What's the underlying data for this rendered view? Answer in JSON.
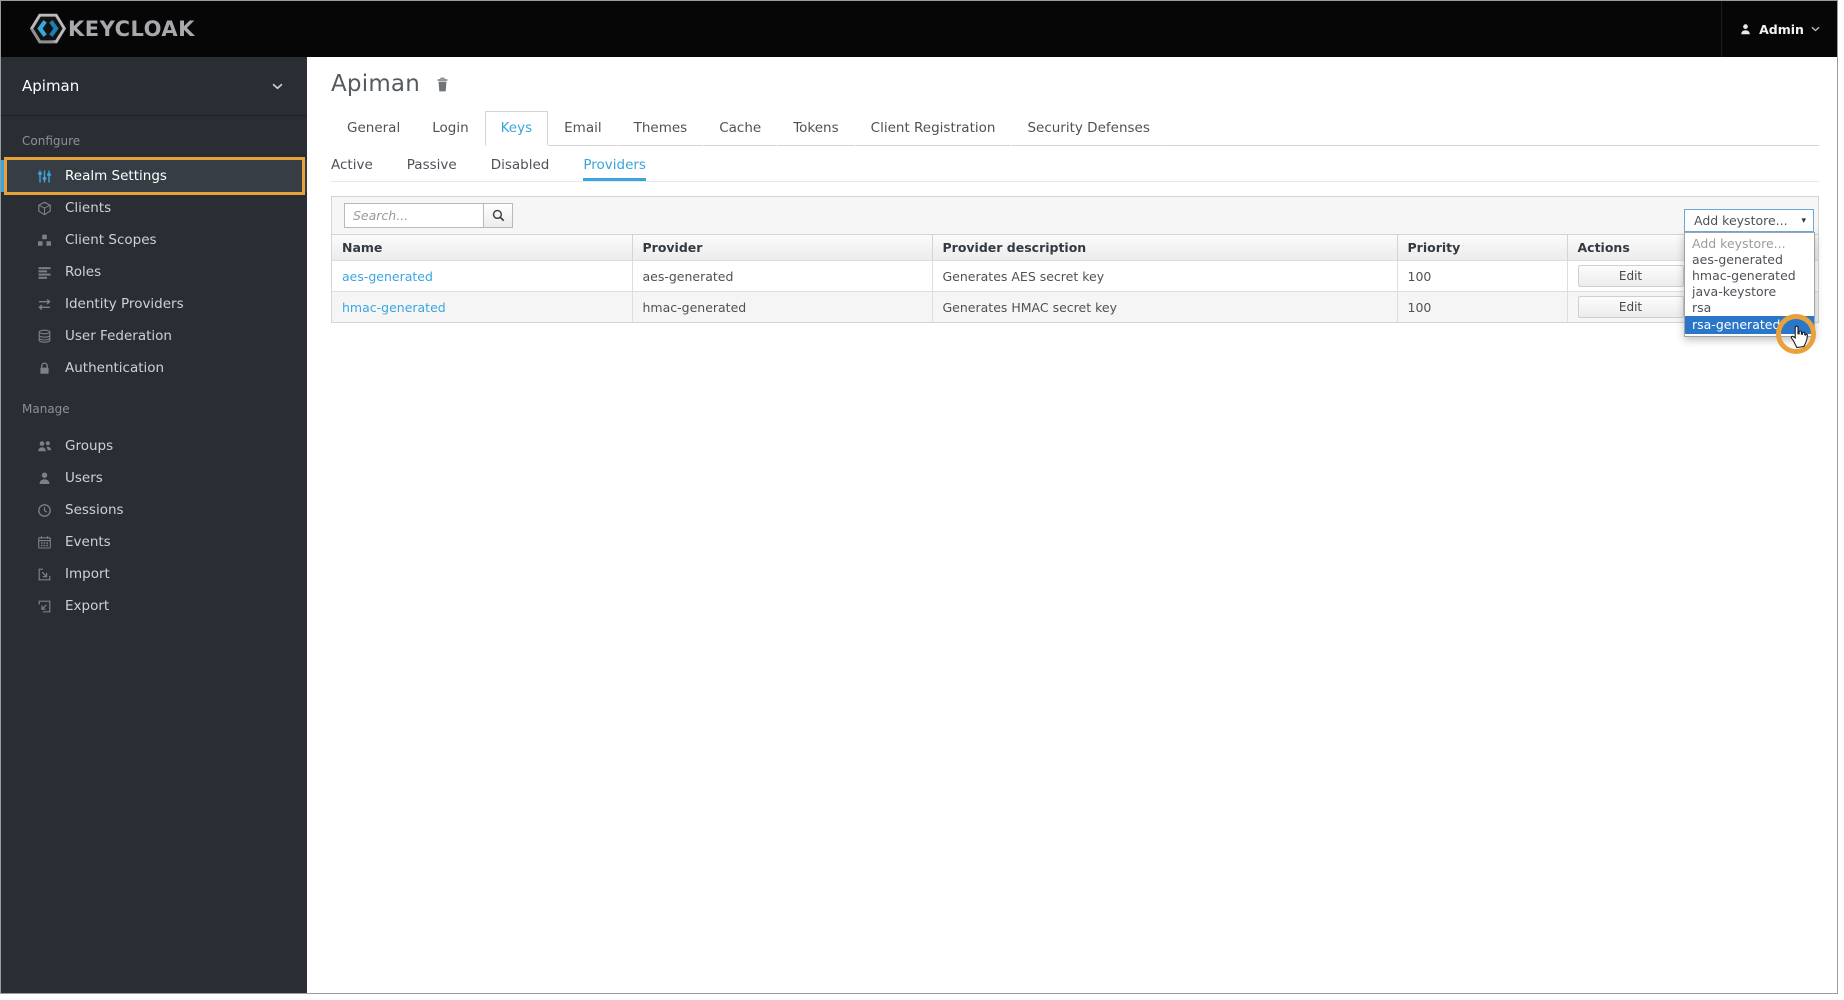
{
  "navbar": {
    "brand": "KEYCLOAK",
    "user_label": "Admin"
  },
  "sidebar": {
    "realm": "Apiman",
    "configure_label": "Configure",
    "manage_label": "Manage",
    "configure_items": [
      {
        "label": "Realm Settings",
        "active": true
      },
      {
        "label": "Clients"
      },
      {
        "label": "Client Scopes"
      },
      {
        "label": "Roles"
      },
      {
        "label": "Identity Providers"
      },
      {
        "label": "User Federation"
      },
      {
        "label": "Authentication"
      }
    ],
    "manage_items": [
      {
        "label": "Groups"
      },
      {
        "label": "Users"
      },
      {
        "label": "Sessions"
      },
      {
        "label": "Events"
      },
      {
        "label": "Import"
      },
      {
        "label": "Export"
      }
    ]
  },
  "main": {
    "title": "Apiman",
    "tabs": [
      {
        "label": "General"
      },
      {
        "label": "Login"
      },
      {
        "label": "Keys",
        "active": true
      },
      {
        "label": "Email"
      },
      {
        "label": "Themes"
      },
      {
        "label": "Cache"
      },
      {
        "label": "Tokens"
      },
      {
        "label": "Client Registration"
      },
      {
        "label": "Security Defenses"
      }
    ],
    "subtabs": [
      {
        "label": "Active"
      },
      {
        "label": "Passive"
      },
      {
        "label": "Disabled"
      },
      {
        "label": "Providers",
        "active": true
      }
    ]
  },
  "toolbar": {
    "search_placeholder": "Search...",
    "add_keystore_label": "Add keystore..."
  },
  "keystore_dropdown": {
    "options": [
      "Add keystore...",
      "aes-generated",
      "hmac-generated",
      "java-keystore",
      "rsa",
      "rsa-generated"
    ],
    "highlighted": "rsa-generated"
  },
  "table": {
    "headers": [
      "Name",
      "Provider",
      "Provider description",
      "Priority",
      "Actions"
    ],
    "rows": [
      {
        "name": "aes-generated",
        "provider": "aes-generated",
        "description": "Generates AES secret key",
        "priority": "100",
        "action": "Edit"
      },
      {
        "name": "hmac-generated",
        "provider": "hmac-generated",
        "description": "Generates HMAC secret key",
        "priority": "100",
        "action": "Edit"
      }
    ]
  },
  "colors": {
    "accent_blue": "#39a5dc",
    "link_blue": "#3aa7df",
    "selection_blue": "#2a76c8",
    "annotation_orange": "#e9a23b"
  }
}
